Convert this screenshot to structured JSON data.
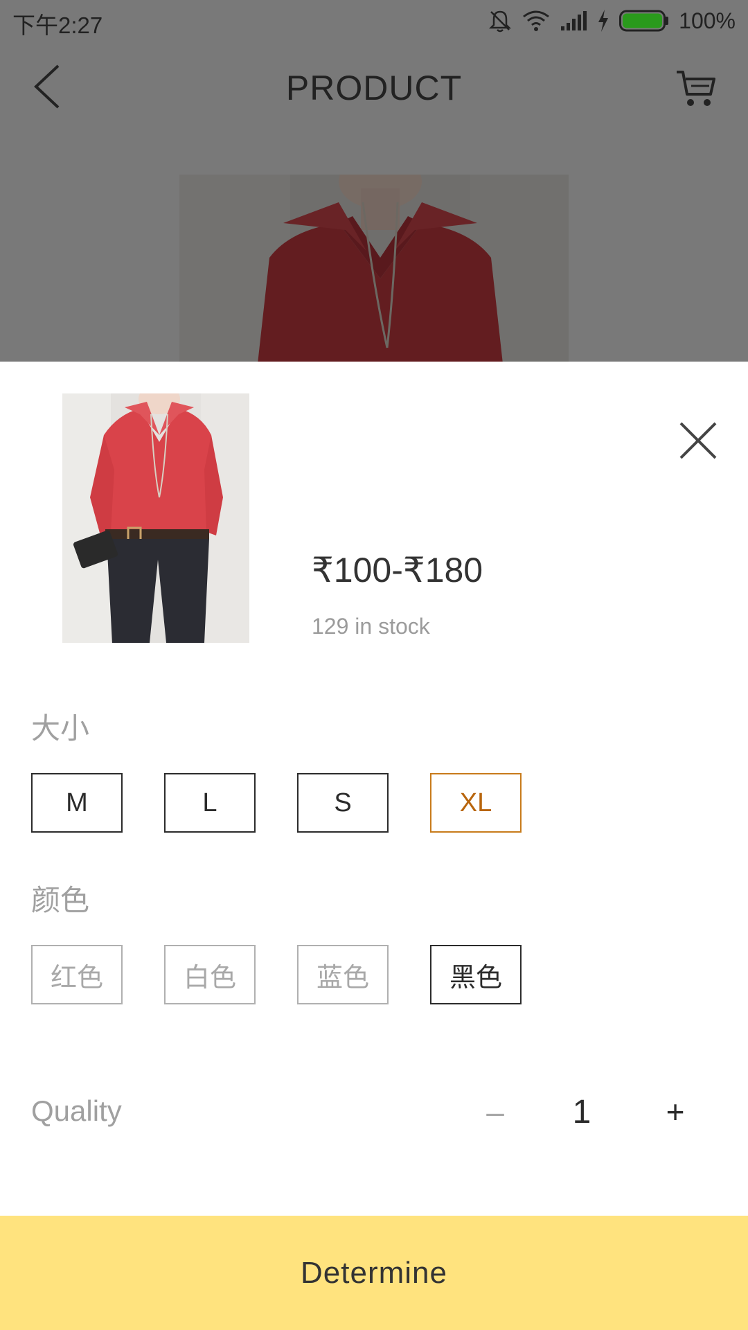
{
  "status_bar": {
    "time": "下午2:27",
    "battery": "100%"
  },
  "header": {
    "title": "PRODUCT",
    "icons": [
      "back-icon",
      "cart-icon"
    ]
  },
  "sheet": {
    "price": "₹100-₹180",
    "stock": "129 in stock",
    "size_label": "大小",
    "sizes": [
      "M",
      "L",
      "S",
      "XL"
    ],
    "selected_size": "XL",
    "color_label": "颜色",
    "colors": [
      "红色",
      "白色",
      "蓝色",
      "黑色"
    ],
    "selected_color": "黑色",
    "quantity_label": "Quality",
    "quantity_value": "1",
    "minus": "–",
    "plus": "+",
    "confirm_label": "Determine"
  },
  "theme": {
    "accent": "#c87b1b",
    "button_bg": "#ffe37e",
    "shirt_red": "#d9434a"
  }
}
